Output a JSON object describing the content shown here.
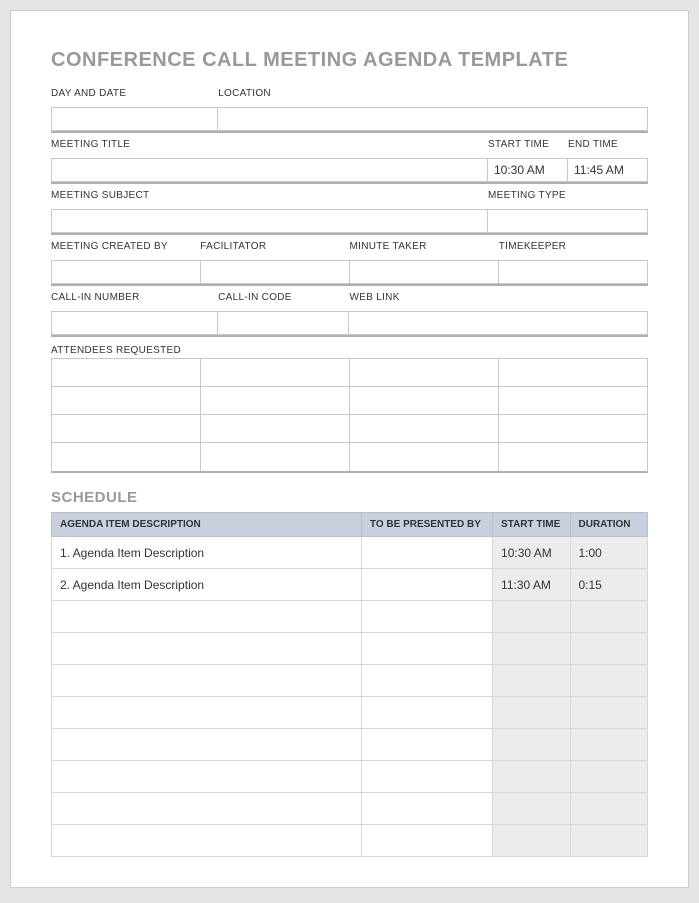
{
  "title": "CONFERENCE CALL MEETING AGENDA TEMPLATE",
  "labels": {
    "day_date": "DAY AND DATE",
    "location": "LOCATION",
    "meeting_title": "MEETING TITLE",
    "start_time": "START TIME",
    "end_time": "END TIME",
    "meeting_subject": "MEETING SUBJECT",
    "meeting_type": "MEETING TYPE",
    "created_by": "MEETING CREATED BY",
    "facilitator": "FACILITATOR",
    "minute_taker": "MINUTE TAKER",
    "timekeeper": "TIMEKEEPER",
    "callin_number": "CALL-IN NUMBER",
    "callin_code": "CALL-IN CODE",
    "web_link": "WEB LINK",
    "attendees": "ATTENDEES REQUESTED"
  },
  "values": {
    "day_date": "",
    "location": "",
    "meeting_title": "",
    "start_time": "10:30 AM",
    "end_time": "11:45 AM",
    "meeting_subject": "",
    "meeting_type": "",
    "created_by": "",
    "facilitator": "",
    "minute_taker": "",
    "timekeeper": "",
    "callin_number": "",
    "callin_code": "",
    "web_link": ""
  },
  "schedule_title": "SCHEDULE",
  "schedule_headers": {
    "desc": "AGENDA ITEM DESCRIPTION",
    "presenter": "TO BE PRESENTED BY",
    "start": "START TIME",
    "duration": "DURATION"
  },
  "schedule": [
    {
      "desc": "1. Agenda Item Description",
      "presenter": "",
      "start": "10:30 AM",
      "duration": "1:00"
    },
    {
      "desc": "2. Agenda Item Description",
      "presenter": "",
      "start": "11:30 AM",
      "duration": "0:15"
    },
    {
      "desc": "",
      "presenter": "",
      "start": "",
      "duration": ""
    },
    {
      "desc": "",
      "presenter": "",
      "start": "",
      "duration": ""
    },
    {
      "desc": "",
      "presenter": "",
      "start": "",
      "duration": ""
    },
    {
      "desc": "",
      "presenter": "",
      "start": "",
      "duration": ""
    },
    {
      "desc": "",
      "presenter": "",
      "start": "",
      "duration": ""
    },
    {
      "desc": "",
      "presenter": "",
      "start": "",
      "duration": ""
    },
    {
      "desc": "",
      "presenter": "",
      "start": "",
      "duration": ""
    },
    {
      "desc": "",
      "presenter": "",
      "start": "",
      "duration": ""
    }
  ]
}
